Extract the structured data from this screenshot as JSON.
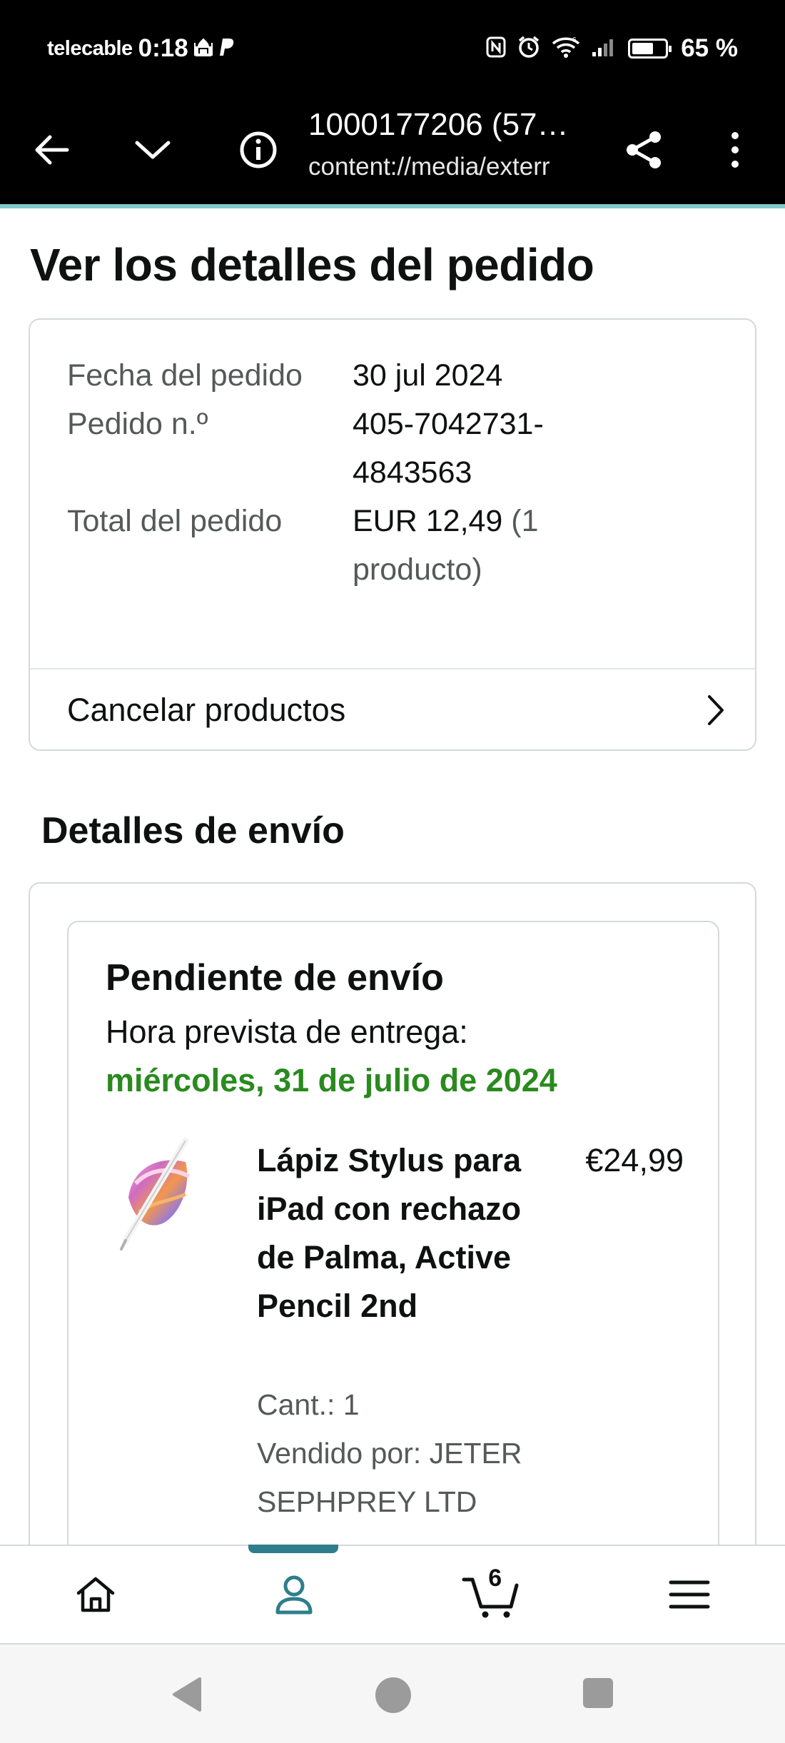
{
  "status_bar": {
    "carrier": "telecable",
    "time": "0:18",
    "battery": "65 %",
    "battery_level": 0.65,
    "icons": [
      "mosque-icon",
      "paypal-icon",
      "nfc-icon",
      "alarm-icon",
      "wifi-icon",
      "signal-icon",
      "battery-icon"
    ]
  },
  "browser": {
    "title": "1000177206 (57…",
    "url": "content://media/exterr"
  },
  "page": {
    "title": "Ver los detalles del pedido"
  },
  "order_summary": {
    "rows": [
      {
        "label": "Fecha del pedido",
        "value": "30 jul 2024",
        "note": ""
      },
      {
        "label": "Pedido n.º",
        "value": "405-7042731-4843563",
        "note": ""
      },
      {
        "label": "Total del pedido",
        "value": "EUR 12,49",
        "note": "(1 producto)"
      }
    ],
    "cancel_label": "Cancelar productos"
  },
  "shipping": {
    "section_title": "Detalles de envío",
    "status": "Pendiente de envío",
    "eta_label": "Hora prevista de entrega:",
    "eta_date": "miércoles, 31 de julio de 2024",
    "product": {
      "title": "Lápiz Stylus para iPad con rechazo de Palma, Active Pencil 2nd",
      "price": "€24,99",
      "quantity": "Cant.: 1",
      "seller": "Vendido por: JETER SEPHPREY LTD"
    }
  },
  "bottom_nav": {
    "active": "account",
    "cart_count": "6",
    "items": [
      "home-icon",
      "account-icon",
      "cart-icon",
      "menu-icon"
    ]
  },
  "colors": {
    "accent": "#2f7d8c",
    "delivery_green": "#2a8a1f",
    "border": "#d5d9d9",
    "muted_text": "#565959"
  }
}
